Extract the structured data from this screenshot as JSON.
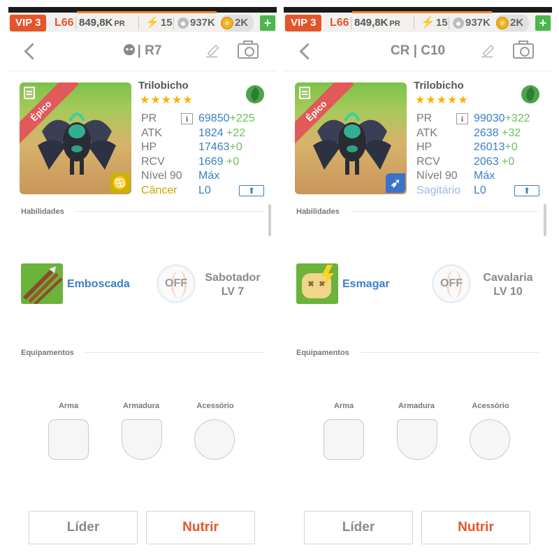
{
  "status_bar": {
    "vip": "VIP 3",
    "level": "L66",
    "power": "849,8K",
    "power_unit": "PR",
    "energy": "15",
    "food": "937K",
    "coins": "2K",
    "add_label": "+"
  },
  "panels": [
    {
      "header_title": "| R7",
      "monster_name": "Trilobicho",
      "rarity": "Épico",
      "stars": "★★★★★",
      "element_icon": "leaf-icon",
      "sign_icon": "cancer-icon",
      "sign_glyph": "♋",
      "sign_color": "#c9b400",
      "stats": [
        {
          "key": "PR",
          "value": "69850",
          "bonus": "+225"
        },
        {
          "key": "ATK",
          "value": "1824",
          "bonus": " +22"
        },
        {
          "key": "HP",
          "value": "17463",
          "bonus": "+0"
        },
        {
          "key": "RCV",
          "value": "1669",
          "bonus": " +0"
        }
      ],
      "level_label": "Nível 90",
      "level_value": "Máx",
      "sign_name": "Câncer",
      "sign_name_color": "#c9a800",
      "sign_level": "L0",
      "skills_title": "Habilidades",
      "skill_name": "Emboscada",
      "skill_icon": "ambush-skill-icon",
      "off_label": "OFF",
      "leader_skill_name": "Sabotador",
      "leader_skill_level": "LV 7",
      "equipment_title": "Equipamentos",
      "equip_labels": [
        "Arma",
        "Armadura",
        "Acessório"
      ],
      "leader_button": "Líder",
      "feed_button": "Nutrir"
    },
    {
      "header_title": "CR | C10",
      "monster_name": "Trilobicho",
      "rarity": "Épico",
      "stars": "★★★★★",
      "element_icon": "leaf-icon",
      "sign_icon": "sagittarius-icon",
      "sign_glyph": "➶",
      "sign_color": "#3a73c9",
      "stats": [
        {
          "key": "PR",
          "value": "99030",
          "bonus": "+322"
        },
        {
          "key": "ATK",
          "value": "2638",
          "bonus": " +32"
        },
        {
          "key": "HP",
          "value": "26013",
          "bonus": "+0"
        },
        {
          "key": "RCV",
          "value": "2063",
          "bonus": " +0"
        }
      ],
      "level_label": "Nível 90",
      "level_value": "Máx",
      "sign_name": "Sagitário",
      "sign_name_color": "#9fb9e0",
      "sign_level": "L0",
      "skills_title": "Habilidades",
      "skill_name": "Esmagar",
      "skill_icon": "smash-skill-icon",
      "off_label": "OFF",
      "leader_skill_name": "Cavalaria",
      "leader_skill_level": "LV 10",
      "equipment_title": "Equipamentos",
      "equip_labels": [
        "Arma",
        "Armadura",
        "Acessório"
      ],
      "leader_button": "Líder",
      "feed_button": "Nutrir"
    }
  ],
  "colors": {
    "accent_orange": "#e4552b",
    "value_blue": "#3b7fc4",
    "bonus_green": "#6bbf59",
    "star_gold": "#f5b400",
    "element_green": "#4aa54a"
  }
}
